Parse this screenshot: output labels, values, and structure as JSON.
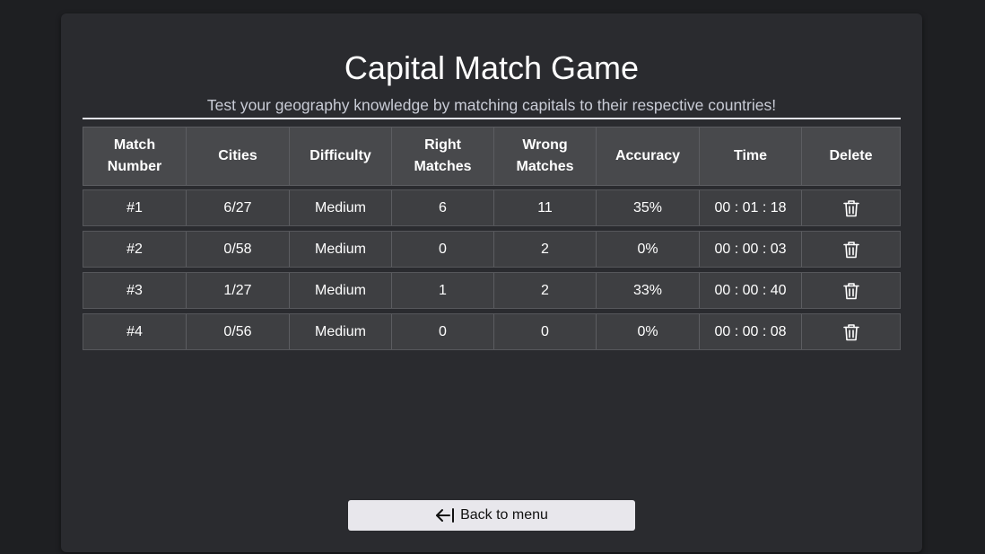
{
  "header": {
    "title": "Capital Match Game",
    "subtitle": "Test your geography knowledge by matching capitals to their respective countries!"
  },
  "table": {
    "columns": [
      "Match Number",
      "Cities",
      "Difficulty",
      "Right Matches",
      "Wrong Matches",
      "Accuracy",
      "Time",
      "Delete"
    ],
    "rows": [
      {
        "match_number": "#1",
        "cities": "6/27",
        "difficulty": "Medium",
        "right": "6",
        "wrong": "11",
        "accuracy": "35%",
        "time": "00 : 01 : 18"
      },
      {
        "match_number": "#2",
        "cities": "0/58",
        "difficulty": "Medium",
        "right": "0",
        "wrong": "2",
        "accuracy": "0%",
        "time": "00 : 00 : 03"
      },
      {
        "match_number": "#3",
        "cities": "1/27",
        "difficulty": "Medium",
        "right": "1",
        "wrong": "2",
        "accuracy": "33%",
        "time": "00 : 00 : 40"
      },
      {
        "match_number": "#4",
        "cities": "0/56",
        "difficulty": "Medium",
        "right": "0",
        "wrong": "0",
        "accuracy": "0%",
        "time": "00 : 00 : 08"
      }
    ],
    "delete_icon": "trash-icon"
  },
  "footer": {
    "back_label": "Back to menu",
    "back_icon": "arrow-left-to-bar-icon"
  }
}
